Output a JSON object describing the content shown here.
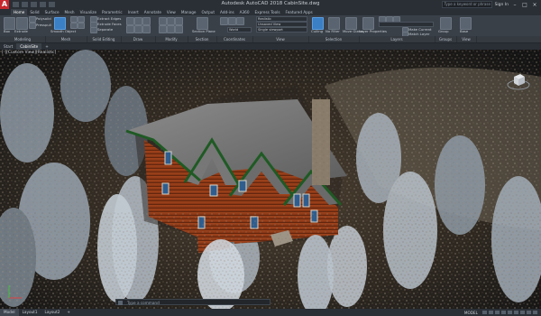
{
  "window": {
    "title": "Autodesk AutoCAD 2018   CabinSite.dwg",
    "search_placeholder": "Type a keyword or phrase",
    "sign_in": "Sign In"
  },
  "tabs": [
    "Home",
    "Solid",
    "Surface",
    "Mesh",
    "Visualize",
    "Parametric",
    "Insert",
    "Annotate",
    "View",
    "Manage",
    "Output",
    "Add-ins",
    "A360",
    "Express Tools",
    "Featured Apps"
  ],
  "ribbon": {
    "buttons": {
      "box": "Box",
      "extrude": "Extrude",
      "polysolid": "Polysolid",
      "presspull": "Presspull",
      "smooth_object": "Smooth Object",
      "extract_edges": "Extract Edges",
      "extrude_faces": "Extrude Faces",
      "separate": "Separate",
      "section_plane": "Section Plane",
      "culling": "Culling",
      "no_filter": "No Filter",
      "move_gizmo": "Move Gizmo",
      "layer_properties": "Layer Properties",
      "make_current": "Make Current",
      "match_layer": "Match Layer",
      "group": "Group",
      "base": "Base"
    },
    "visual_style": "Realistic",
    "unsaved_view": "Unsaved View",
    "single_viewport": "Single viewport",
    "world": "World",
    "panels": [
      "Modeling",
      "Mesh",
      "Solid Editing",
      "Draw",
      "Modify",
      "Section",
      "Coordinates",
      "View",
      "Selection",
      "Layers",
      "Groups",
      "View"
    ]
  },
  "file_tabs": [
    "Start",
    "CabinSite"
  ],
  "viewport": {
    "label": "[-][Custom View][Realistic]"
  },
  "command_line": {
    "placeholder": "Type a command"
  },
  "status_bar": {
    "layout_tabs": [
      "Model",
      "Layout1",
      "Layout2"
    ],
    "model_label": "MODEL"
  }
}
